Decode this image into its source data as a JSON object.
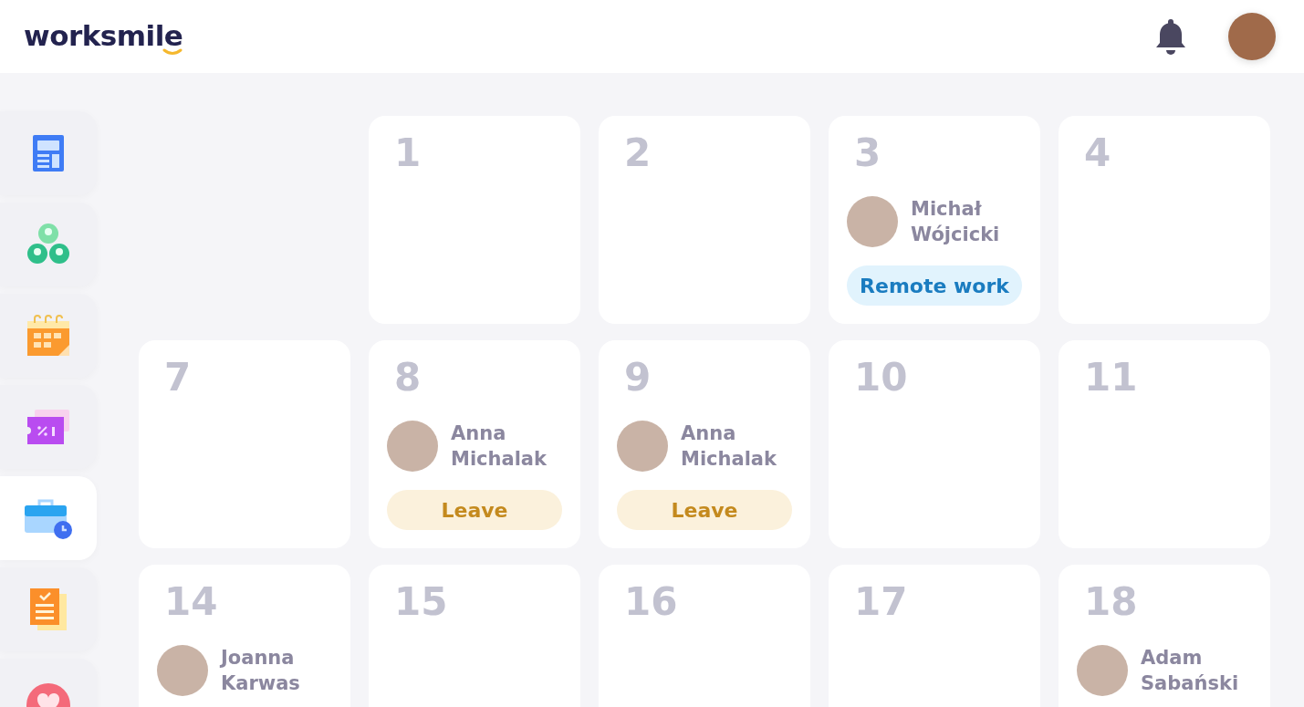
{
  "header": {
    "logo": "worksmile"
  },
  "sidebar": {
    "items": [
      {
        "selected": false
      },
      {
        "selected": false
      },
      {
        "selected": false
      },
      {
        "selected": false
      },
      {
        "selected": true
      },
      {
        "selected": false
      },
      {
        "selected": false
      }
    ]
  },
  "calendar": {
    "rows": [
      [
        {
          "kind": "blank"
        },
        {
          "kind": "day",
          "day": "1"
        },
        {
          "kind": "day",
          "day": "2"
        },
        {
          "kind": "day",
          "day": "3",
          "entries": [
            {
              "name": "Michał Wójcicki",
              "status": {
                "kind": "remote",
                "label": "Remote work"
              }
            }
          ]
        },
        {
          "kind": "day",
          "day": "4"
        }
      ],
      [
        {
          "kind": "day",
          "day": "7"
        },
        {
          "kind": "day",
          "day": "8",
          "entries": [
            {
              "name": "Anna Michalak",
              "status": {
                "kind": "leave",
                "label": "Leave"
              }
            }
          ]
        },
        {
          "kind": "day",
          "day": "9",
          "entries": [
            {
              "name": "Anna Michalak",
              "status": {
                "kind": "leave",
                "label": "Leave"
              }
            }
          ]
        },
        {
          "kind": "day",
          "day": "10"
        },
        {
          "kind": "day",
          "day": "11"
        }
      ],
      [
        {
          "kind": "day",
          "day": "14",
          "entries": [
            {
              "name": "Joanna Karwas"
            }
          ]
        },
        {
          "kind": "day",
          "day": "15"
        },
        {
          "kind": "day",
          "day": "16"
        },
        {
          "kind": "day",
          "day": "17"
        },
        {
          "kind": "day",
          "day": "18",
          "entries": [
            {
              "name": "Adam Sabański"
            }
          ]
        }
      ]
    ]
  }
}
